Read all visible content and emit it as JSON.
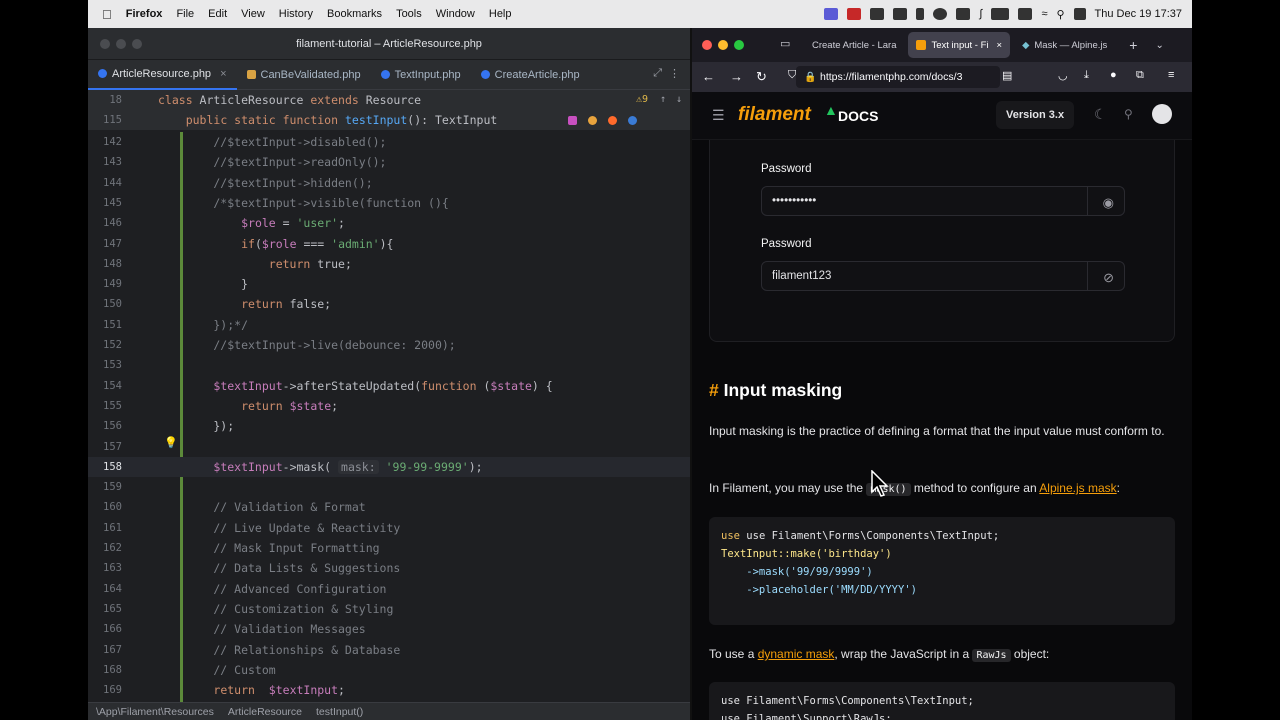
{
  "menubar": {
    "app": "Firefox",
    "items": [
      "File",
      "Edit",
      "View",
      "History",
      "Bookmarks",
      "Tools",
      "Window",
      "Help"
    ],
    "datetime": "Thu Dec 19  17:37"
  },
  "ide": {
    "title": "filament-tutorial – ArticleResource.php",
    "tabs": [
      {
        "label": "ArticleResource.php",
        "color": "#3574f0",
        "active": true
      },
      {
        "label": "CanBeValidated.php",
        "color": "#d9a343",
        "active": false
      },
      {
        "label": "TextInput.php",
        "color": "#3574f0",
        "active": false
      },
      {
        "label": "CreateArticle.php",
        "color": "#3574f0",
        "active": false
      }
    ],
    "warnings": "9",
    "breadcrumb": [
      "\\App\\Filament\\Resources",
      "ArticleResource",
      "testInput()"
    ],
    "sticky": [
      {
        "num": "18",
        "code": "class ArticleResource extends Resource"
      },
      {
        "num": "115",
        "code": "    public static function testInput(): TextInput"
      }
    ],
    "lines": [
      {
        "num": "142",
        "code": "        //$textInput->disabled();"
      },
      {
        "num": "143",
        "code": "        //$textInput->readOnly();"
      },
      {
        "num": "144",
        "code": "        //$textInput->hidden();"
      },
      {
        "num": "145",
        "code": "        /*$textInput->visible(function (){"
      },
      {
        "num": "146",
        "code": "            $role = 'user';"
      },
      {
        "num": "147",
        "code": "            if($role === 'admin'){"
      },
      {
        "num": "148",
        "code": "                return true;"
      },
      {
        "num": "149",
        "code": "            }"
      },
      {
        "num": "150",
        "code": "            return false;"
      },
      {
        "num": "151",
        "code": "        });*/"
      },
      {
        "num": "152",
        "code": "        //$textInput->live(debounce: 2000);"
      },
      {
        "num": "153",
        "code": ""
      },
      {
        "num": "154",
        "code": "        $textInput->afterStateUpdated(function ($state) {"
      },
      {
        "num": "155",
        "code": "            return $state;"
      },
      {
        "num": "156",
        "code": "        });"
      },
      {
        "num": "157",
        "code": ""
      },
      {
        "num": "158",
        "code": "        $textInput->mask( mask: '99-99-9999');"
      },
      {
        "num": "159",
        "code": ""
      },
      {
        "num": "160",
        "code": "        // Validation & Format"
      },
      {
        "num": "161",
        "code": "        // Live Update & Reactivity"
      },
      {
        "num": "162",
        "code": "        // Mask Input Formatting"
      },
      {
        "num": "163",
        "code": "        // Data Lists & Suggestions"
      },
      {
        "num": "164",
        "code": "        // Advanced Configuration"
      },
      {
        "num": "165",
        "code": "        // Customization & Styling"
      },
      {
        "num": "166",
        "code": "        // Validation Messages"
      },
      {
        "num": "167",
        "code": "        // Relationships & Database"
      },
      {
        "num": "168",
        "code": "        // Custom"
      },
      {
        "num": "169",
        "code": "        return  $textInput;"
      }
    ]
  },
  "browser": {
    "tabs": [
      {
        "label": "Create Article - Lara",
        "active": false
      },
      {
        "label": "Text input - Fi",
        "active": true
      },
      {
        "label": "Mask — Alpine.js",
        "active": false
      }
    ],
    "url": "https://filamentphp.com/docs/3",
    "site": {
      "logo": "filament",
      "docs": "DOCS",
      "version": "Version 3.x"
    },
    "form": {
      "label1": "Password",
      "value1": "•••••••••••",
      "label2": "Password",
      "value2": "filament123"
    },
    "heading": "Input masking",
    "p1": "Input masking is the practice of defining a format that the input value must conform to.",
    "p2a": "In Filament, you may use the ",
    "p2code": "mask()",
    "p2b": " method to configure an ",
    "p2link": "Alpine.js mask",
    "p2c": ":",
    "code1": [
      "use Filament\\Forms\\Components\\TextInput;",
      "",
      "TextInput::make('birthday')",
      "    ->mask('99/99/9999')",
      "    ->placeholder('MM/DD/YYYY')"
    ],
    "p3a": "To use a ",
    "p3link": "dynamic mask",
    "p3b": ", wrap the JavaScript in a ",
    "p3code": "RawJs",
    "p3c": " object:",
    "code2": [
      "use Filament\\Forms\\Components\\TextInput;",
      "use Filament\\Support\\RawJs;"
    ]
  }
}
